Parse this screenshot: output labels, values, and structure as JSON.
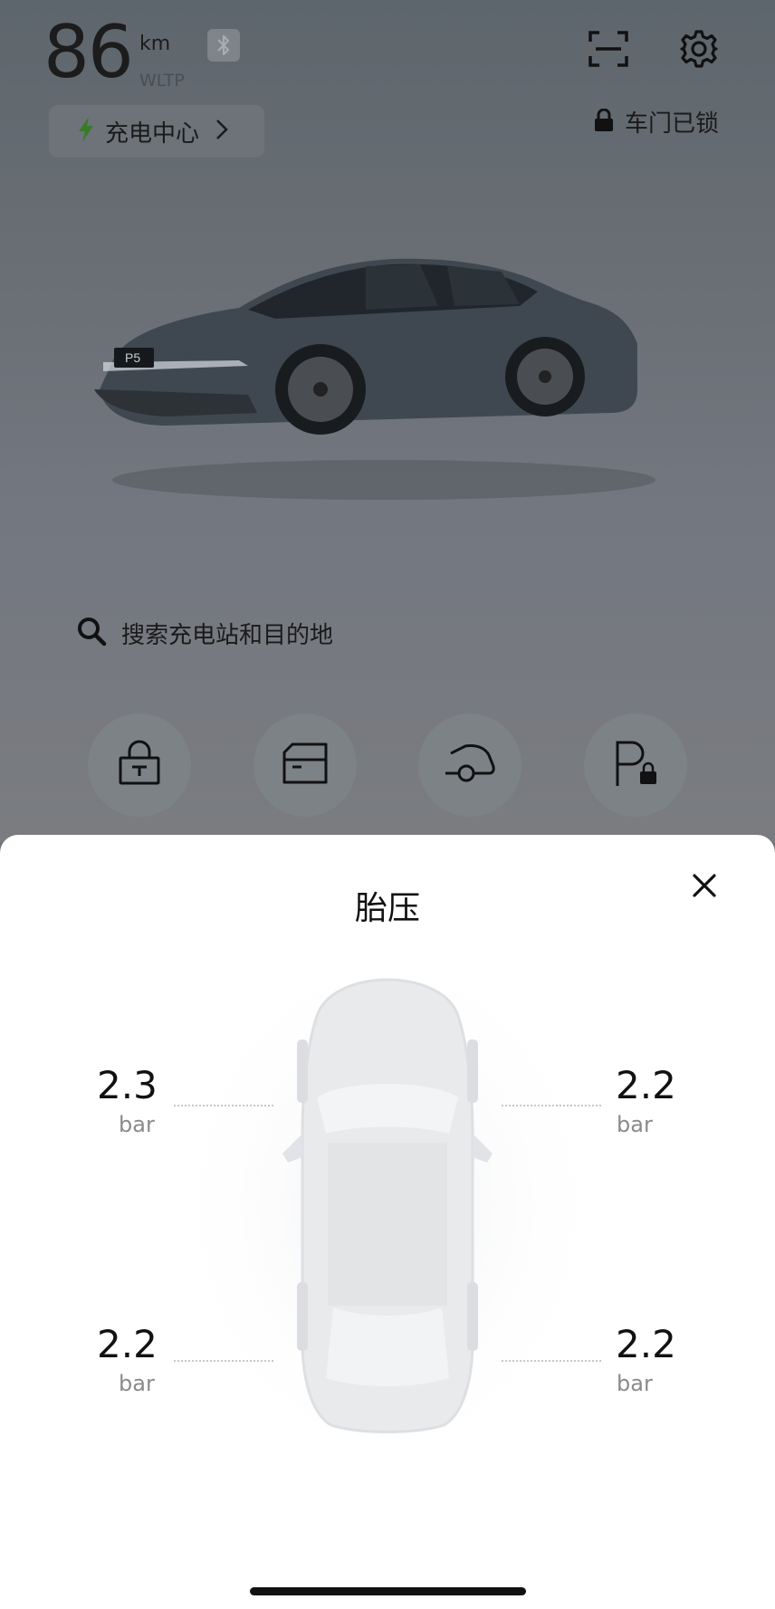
{
  "status": {
    "range_value": "86",
    "range_unit": "km",
    "range_standard": "WLTP",
    "bluetooth_icon": "bluetooth-icon"
  },
  "charging_center": {
    "label": "充电中心",
    "icon": "lightning-icon",
    "accent": "#3a7a2a"
  },
  "lock_status": {
    "label": "车门已锁",
    "icon": "lock-icon"
  },
  "vehicle": {
    "plate": "P5"
  },
  "search": {
    "placeholder": "搜索充电站和目的地"
  },
  "quick_actions": [
    "lock-icon",
    "trunk-icon",
    "frunk-icon",
    "parking-lock-icon"
  ],
  "tire_sheet": {
    "title": "胎压",
    "tires": {
      "front_left": {
        "value": "2.3",
        "unit": "bar"
      },
      "front_right": {
        "value": "2.2",
        "unit": "bar"
      },
      "rear_left": {
        "value": "2.2",
        "unit": "bar"
      },
      "rear_right": {
        "value": "2.2",
        "unit": "bar"
      }
    }
  }
}
